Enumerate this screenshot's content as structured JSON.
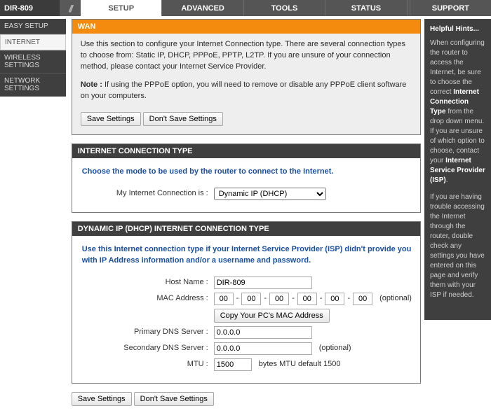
{
  "model": "DIR-809",
  "tabs": {
    "setup": "SETUP",
    "advanced": "ADVANCED",
    "tools": "TOOLS",
    "status": "STATUS",
    "support": "SUPPORT"
  },
  "sidebar": {
    "easy_setup": "EASY SETUP",
    "internet": "INTERNET",
    "wireless": "WIRELESS SETTINGS",
    "network": "NETWORK SETTINGS"
  },
  "wan": {
    "title": "WAN",
    "intro": "Use this section to configure your Internet Connection type. There are several connection types to choose from: Static IP, DHCP, PPPoE, PPTP, L2TP. If you are unsure of your connection method, please contact your Internet Service Provider.",
    "note_label": "Note :",
    "note_text": " If using the PPPoE option, you will need to remove or disable any PPPoE client software on your computers.",
    "save": "Save Settings",
    "dont_save": "Don't Save Settings"
  },
  "ict": {
    "title": "INTERNET CONNECTION TYPE",
    "intro": "Choose the mode to be used by the router to connect to the Internet.",
    "label": "My Internet Connection is :",
    "value": "Dynamic IP (DHCP)"
  },
  "dhcp": {
    "title": "DYNAMIC IP (DHCP) INTERNET CONNECTION TYPE",
    "intro": "Use this Internet connection type if your Internet Service Provider (ISP) didn't provide you with IP Address information and/or a username and password.",
    "host_label": "Host Name :",
    "host_value": "DIR-809",
    "mac_label": "MAC Address :",
    "mac_oct": "00",
    "mac_sep": "-",
    "mac_optional": "(optional)",
    "copy_mac": "Copy Your PC's MAC Address",
    "pdns_label": "Primary DNS Server :",
    "pdns_value": "0.0.0.0",
    "sdns_label": "Secondary DNS Server :",
    "sdns_value": "0.0.0.0",
    "sdns_optional": "(optional)",
    "mtu_label": "MTU :",
    "mtu_value": "1500",
    "mtu_suffix": "bytes MTU default 1500"
  },
  "bottom": {
    "save": "Save Settings",
    "dont_save": "Don't Save Settings"
  },
  "hints": {
    "title": "Helpful Hints...",
    "p1a": "When configuring the router to access the Internet, be sure to choose the correct ",
    "p1b": "Internet Connection Type",
    "p1c": " from the drop down menu. If you are unsure of which option to choose, contact your ",
    "p1d": "Internet Service Provider (ISP)",
    "p1e": ".",
    "p2": "If you are having trouble accessing the Internet through the router, double check any settings you have entered on this page and verify them with your ISP if needed."
  }
}
